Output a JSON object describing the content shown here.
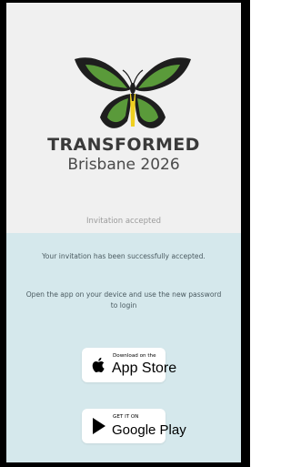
{
  "brand": {
    "title": "TRANSFORMED",
    "subtitle": "Brisbane 2026"
  },
  "status": "Invitation accepted",
  "messages": {
    "success": "Your invitation has been successfully accepted.",
    "instructions": "Open the app on your device and use the new password to login"
  },
  "stores": {
    "apple": {
      "small": "Download on the",
      "big": "App Store"
    },
    "google": {
      "small": "GET IT ON",
      "big": "Google Play"
    }
  },
  "colors": {
    "panel": "#d5e8ec",
    "butterfly_green": "#5a9a3a",
    "butterfly_yellow": "#f0d020"
  }
}
